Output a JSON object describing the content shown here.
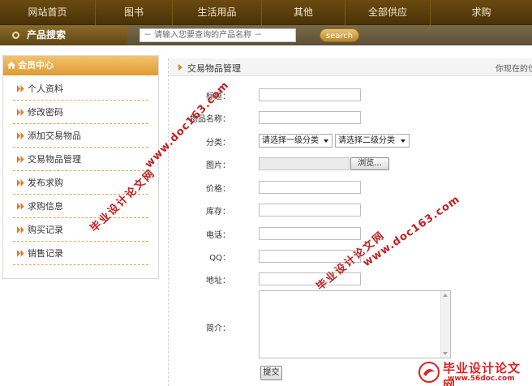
{
  "nav": {
    "items": [
      "网站首页",
      "图书",
      "生活用品",
      "其他",
      "全部供应",
      "求购"
    ]
  },
  "search": {
    "label": "产品搜索",
    "placeholder": "－ 请输入您要查询的产品名称 －",
    "button_label": "search"
  },
  "sidebar": {
    "title": "会员中心",
    "items": [
      "个人资料",
      "修改密码",
      "添加交易物品",
      "交易物品管理",
      "发布求购",
      "求购信息",
      "购买记录",
      "销售记录"
    ]
  },
  "main": {
    "title": "交易物品管理",
    "breadcrumb": "你现在的位"
  },
  "form": {
    "title_label": "标题：",
    "name_label": "物品名称：",
    "category_label": "分类：",
    "category1_value": "请选择一级分类",
    "category2_value": "请选择二级分类",
    "image_label": "图片：",
    "browse_label": "浏览...",
    "price_label": "价格：",
    "stock_label": "库存：",
    "phone_label": "电话：",
    "qq_label": "QQ：",
    "address_label": "地址：",
    "intro_label": "简介：",
    "submit_label": "提交"
  },
  "watermark": {
    "url": "www.doc163.com",
    "cn": "毕业设计论文网",
    "logo_cn": "毕业设计论文网",
    "logo_url": "www.56doc.com"
  },
  "colors": {
    "nav_bg": "#5a3d0c",
    "accent": "#e0a040",
    "watermark": "#c51e1e"
  }
}
